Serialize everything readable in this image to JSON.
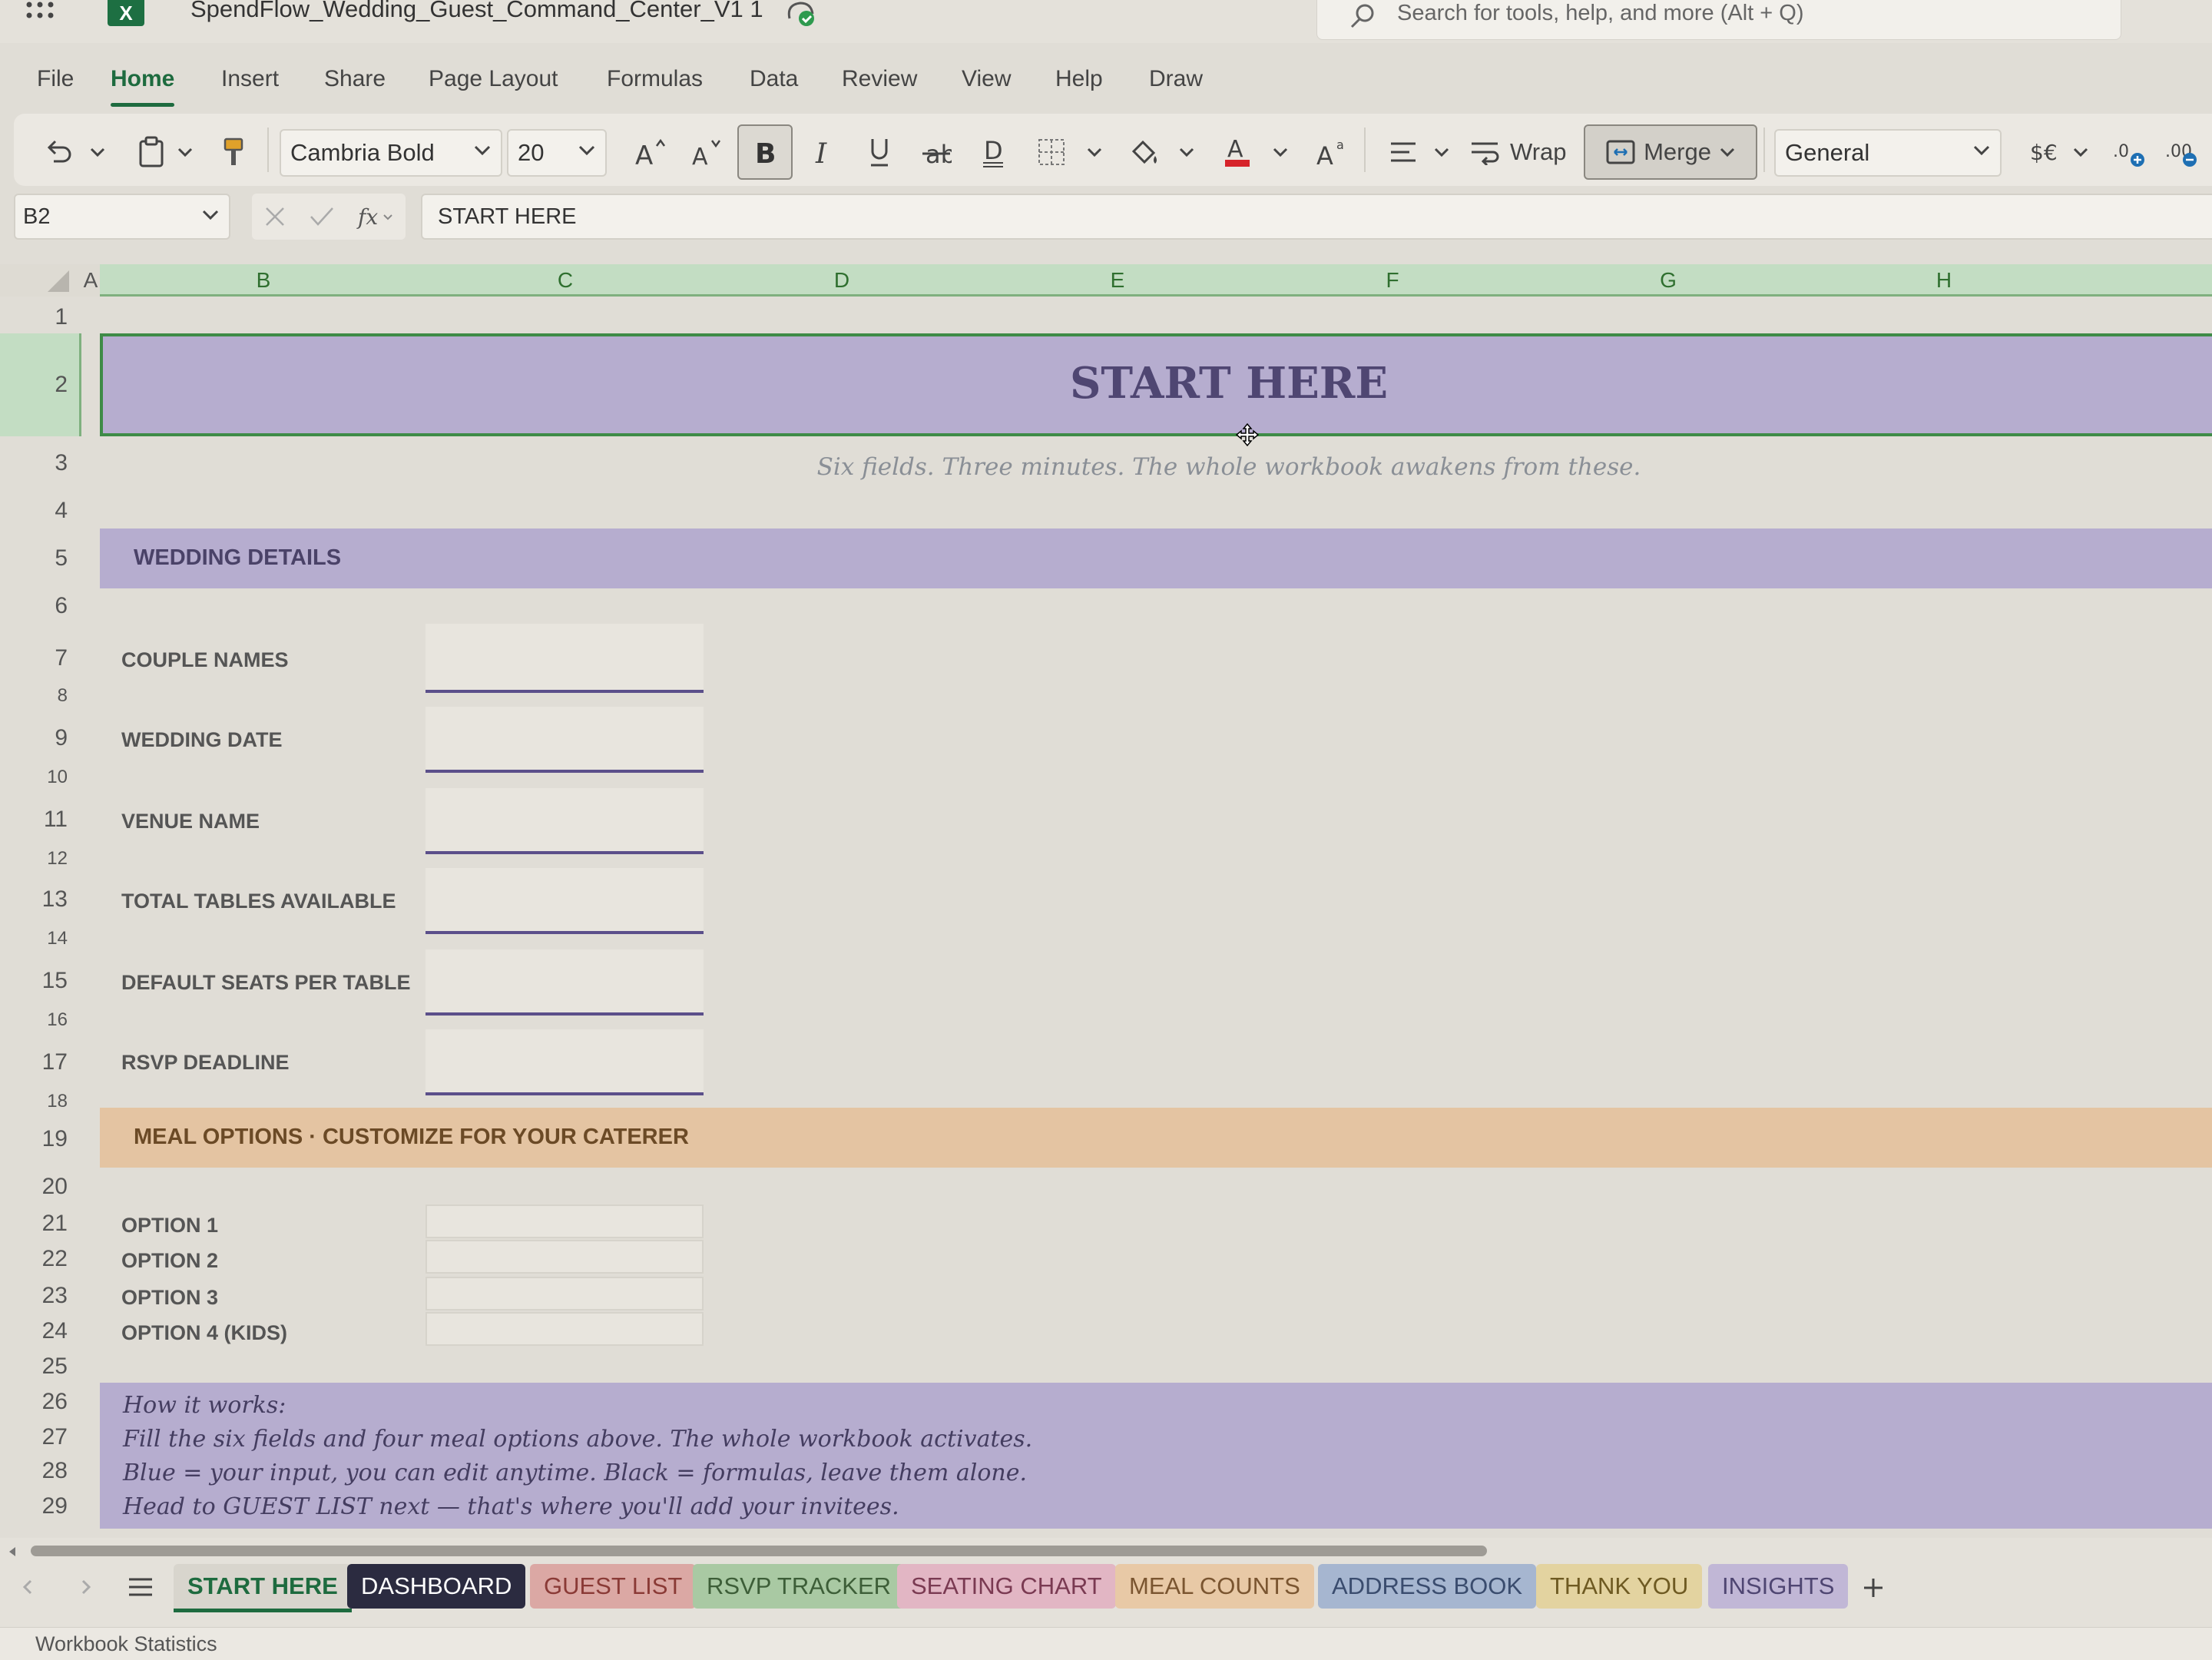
{
  "window": {
    "file_title": "SpendFlow_Wedding_Guest_Command_Center_V1 1",
    "search_placeholder": "Search for tools, help, and more (Alt + Q)"
  },
  "menu": [
    "File",
    "Home",
    "Insert",
    "Share",
    "Page Layout",
    "Formulas",
    "Data",
    "Review",
    "View",
    "Help",
    "Draw"
  ],
  "ribbon": {
    "font_name": "Cambria Bold",
    "font_size": "20",
    "wrap_label": "Wrap",
    "merge_label": "Merge",
    "number_format": "General"
  },
  "formula_bar": {
    "cell_ref": "B2",
    "formula": "START HERE"
  },
  "columns": [
    "A",
    "B",
    "C",
    "D",
    "E",
    "F",
    "G",
    "H"
  ],
  "rows": [
    "1",
    "2",
    "3",
    "4",
    "5",
    "6",
    "7",
    "8",
    "9",
    "10",
    "11",
    "12",
    "13",
    "14",
    "15",
    "16",
    "17",
    "18",
    "19",
    "20",
    "21",
    "22",
    "23",
    "24",
    "25",
    "26",
    "27",
    "28",
    "29"
  ],
  "sheet": {
    "title": "START HERE",
    "subtitle": "Six fields. Three minutes. The whole workbook awakens from these.",
    "wedding_section": "WEDDING DETAILS",
    "fields": [
      "COUPLE NAMES",
      "WEDDING DATE",
      "VENUE NAME",
      "TOTAL TABLES AVAILABLE",
      "DEFAULT SEATS PER TABLE",
      "RSVP DEADLINE"
    ],
    "meal_section": "MEAL OPTIONS · CUSTOMIZE FOR YOUR CATERER",
    "meal_options": [
      "OPTION 1",
      "OPTION 2",
      "OPTION 3",
      "OPTION 4 (KIDS)"
    ],
    "how_it_works": [
      "How it works:",
      "Fill the six fields and four meal options above. The whole workbook activates.",
      "Blue = your input, you can edit anytime. Black = formulas, leave them alone.",
      "Head to GUEST LIST next — that's where you'll add your invitees."
    ]
  },
  "tabs": [
    {
      "label": "START HERE",
      "active": true
    },
    {
      "label": "DASHBOARD"
    },
    {
      "label": "GUEST LIST"
    },
    {
      "label": "RSVP TRACKER"
    },
    {
      "label": "SEATING CHART"
    },
    {
      "label": "MEAL COUNTS"
    },
    {
      "label": "ADDRESS BOOK"
    },
    {
      "label": "THANK YOU"
    },
    {
      "label": "INSIGHTS"
    }
  ],
  "status": "Workbook Statistics",
  "colors": {
    "accent_green": "#1e6b3f",
    "title_band": "#b6adcf",
    "meal_band": "#e4c4a2",
    "tab_dashboard": "#2b2b40",
    "tab_guest": "#dba8a4",
    "tab_rsvp": "#a9c9a3",
    "tab_seating": "#e2b6c4",
    "tab_meal": "#e8c9a6",
    "tab_address": "#a6b6d0",
    "tab_thank": "#e3d3a0",
    "tab_insights": "#c1b7d6"
  }
}
